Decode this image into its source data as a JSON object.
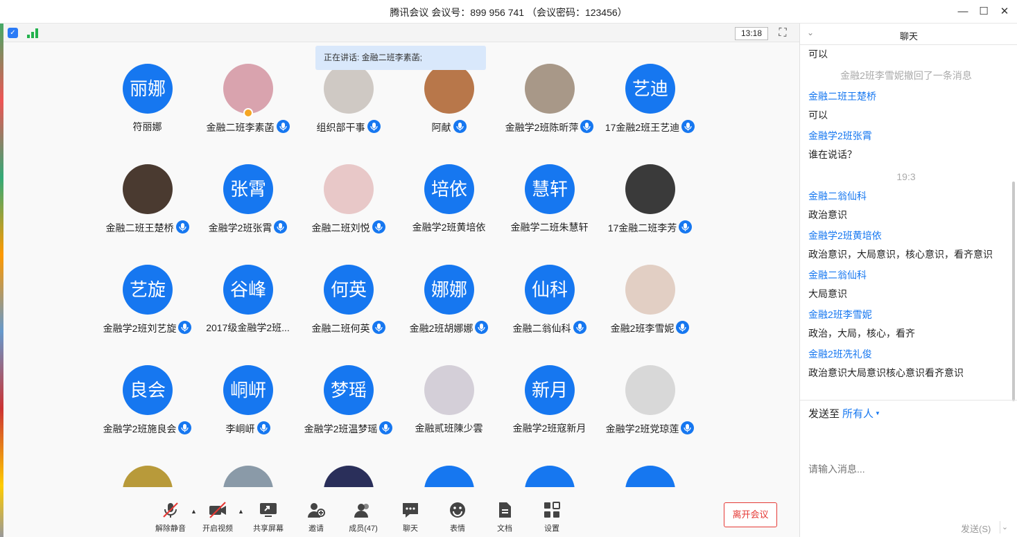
{
  "window": {
    "title": "腾讯会议 会议号：899 956 741 （会议密码：123456）",
    "minimize_icon": "minimize-icon",
    "maximize_icon": "maximize-icon",
    "close_icon": "close-icon"
  },
  "topbar": {
    "time": "13:18"
  },
  "speaking_banner": "正在讲话: 金融二班李素菡;",
  "participants": [
    {
      "avatar_text": "丽娜",
      "name": "符丽娜",
      "mic": false,
      "photo": false,
      "color": "#1677f0"
    },
    {
      "avatar_text": "",
      "name": "金融二班李素菡",
      "mic": true,
      "photo": true,
      "color": "#d9a3ae",
      "host": true
    },
    {
      "avatar_text": "",
      "name": "组织部干事",
      "mic": true,
      "photo": true,
      "color": "#cfc9c4"
    },
    {
      "avatar_text": "",
      "name": "阿献",
      "mic": true,
      "photo": true,
      "color": "#b8774a"
    },
    {
      "avatar_text": "",
      "name": "金融学2班陈昕萍",
      "mic": true,
      "photo": true,
      "color": "#a89888"
    },
    {
      "avatar_text": "艺迪",
      "name": "17金融2班王艺迪",
      "mic": true,
      "photo": false,
      "color": "#1677f0"
    },
    {
      "avatar_text": "",
      "name": "金融二班王楚桥",
      "mic": true,
      "photo": true,
      "color": "#4a3a30"
    },
    {
      "avatar_text": "张霄",
      "name": "金融学2班张霄",
      "mic": true,
      "photo": false,
      "color": "#1677f0"
    },
    {
      "avatar_text": "",
      "name": "金融二班刘悦",
      "mic": true,
      "photo": true,
      "color": "#e8c8c8"
    },
    {
      "avatar_text": "培依",
      "name": "金融学2班黄培依",
      "mic": false,
      "photo": false,
      "color": "#1677f0"
    },
    {
      "avatar_text": "慧轩",
      "name": "金融学二班朱慧轩",
      "mic": false,
      "photo": false,
      "color": "#1677f0"
    },
    {
      "avatar_text": "",
      "name": "17金融二班李芳",
      "mic": true,
      "photo": true,
      "color": "#3a3a3a"
    },
    {
      "avatar_text": "艺旋",
      "name": "金融学2班刘艺旋",
      "mic": true,
      "photo": false,
      "color": "#1677f0"
    },
    {
      "avatar_text": "谷峰",
      "name": "2017级金融学2班...",
      "mic": false,
      "photo": false,
      "color": "#1677f0"
    },
    {
      "avatar_text": "何英",
      "name": "金融二班何英",
      "mic": true,
      "photo": false,
      "color": "#1677f0"
    },
    {
      "avatar_text": "娜娜",
      "name": "金融2班胡娜娜",
      "mic": true,
      "photo": false,
      "color": "#1677f0"
    },
    {
      "avatar_text": "仙科",
      "name": "金融二翁仙科",
      "mic": true,
      "photo": false,
      "color": "#1677f0"
    },
    {
      "avatar_text": "",
      "name": "金融2班李雪妮",
      "mic": true,
      "photo": true,
      "color": "#e2cfc4"
    },
    {
      "avatar_text": "良会",
      "name": "金融学2班施良会",
      "mic": true,
      "photo": false,
      "color": "#1677f0"
    },
    {
      "avatar_text": "峒岍",
      "name": "李峒岍",
      "mic": true,
      "photo": false,
      "color": "#1677f0"
    },
    {
      "avatar_text": "梦瑶",
      "name": "金融学2班温梦瑶",
      "mic": true,
      "photo": false,
      "color": "#1677f0"
    },
    {
      "avatar_text": "",
      "name": "金融贰班陳少雲",
      "mic": false,
      "photo": true,
      "color": "#d4cfd8"
    },
    {
      "avatar_text": "新月",
      "name": "金融学2班寇新月",
      "mic": false,
      "photo": false,
      "color": "#1677f0"
    },
    {
      "avatar_text": "",
      "name": "金融学2班党琼莲",
      "mic": true,
      "photo": true,
      "color": "#d8d8d8"
    },
    {
      "avatar_text": "",
      "name": "",
      "mic": false,
      "photo": true,
      "color": "#b89a3a"
    },
    {
      "avatar_text": "",
      "name": "",
      "mic": false,
      "photo": true,
      "color": "#8a9aa8"
    },
    {
      "avatar_text": "",
      "name": "",
      "mic": false,
      "photo": true,
      "color": "#2a2f5a"
    },
    {
      "avatar_text": "",
      "name": "",
      "mic": false,
      "photo": false,
      "color": "#1677f0"
    },
    {
      "avatar_text": "",
      "name": "",
      "mic": false,
      "photo": false,
      "color": "#1677f0"
    },
    {
      "avatar_text": "",
      "name": "",
      "mic": false,
      "photo": false,
      "color": "#1677f0"
    }
  ],
  "toolbar": {
    "unmute": "解除静音",
    "start_video": "开启视频",
    "share_screen": "共享屏幕",
    "invite": "邀请",
    "members": "成员(47)",
    "chat": "聊天",
    "emoji": "表情",
    "docs": "文档",
    "settings": "设置",
    "leave": "离开会议"
  },
  "chat": {
    "title": "聊天",
    "messages": [
      {
        "kind": "text",
        "text": "可以"
      },
      {
        "kind": "sys",
        "text": "金融2班李雪妮撤回了一条消息"
      },
      {
        "kind": "sender",
        "text": "金融二班王楚桥"
      },
      {
        "kind": "text",
        "text": "可以"
      },
      {
        "kind": "sender",
        "text": "金融学2班张霄"
      },
      {
        "kind": "text",
        "text": "谁在说话？"
      },
      {
        "kind": "sys",
        "text": "19:3"
      },
      {
        "kind": "sender",
        "text": "金融二翁仙科"
      },
      {
        "kind": "text",
        "text": "政治意识"
      },
      {
        "kind": "sender",
        "text": "金融学2班黄培依"
      },
      {
        "kind": "text",
        "text": "政治意识，大局意识，核心意识，看齐意识"
      },
      {
        "kind": "sender",
        "text": "金融二翁仙科"
      },
      {
        "kind": "text",
        "text": "大局意识"
      },
      {
        "kind": "sender",
        "text": "金融2班李雪妮"
      },
      {
        "kind": "text",
        "text": "政治，大局，核心，看齐"
      },
      {
        "kind": "sender",
        "text": "金融2班冼礼俊"
      },
      {
        "kind": "text",
        "text": "政治意识大局意识核心意识看齐意识"
      }
    ],
    "send_to_label": "发送至",
    "send_to_target": "所有人",
    "input_placeholder": "请输入消息...",
    "send_button": "发送(S)"
  }
}
